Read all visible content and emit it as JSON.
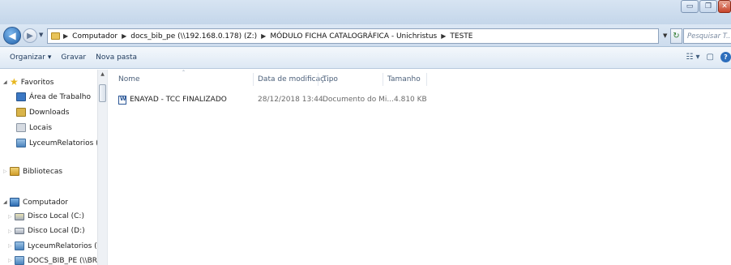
{
  "window_controls": {
    "minimize": "▭",
    "maximize": "❐",
    "close": "✕"
  },
  "address": {
    "crumbs": [
      "Computador",
      "docs_bib_pe (\\\\192.168.0.178) (Z:)",
      "MÓDULO FICHA CATALOGRÁFICA - Unichristus",
      "TESTE"
    ],
    "search_placeholder": "Pesquisar T..."
  },
  "toolbar": {
    "organize_label": "Organizar ▾",
    "burn_label": "Gravar",
    "new_folder_label": "Nova pasta"
  },
  "nav": {
    "favorites": "Favoritos",
    "desktop": "Área de Trabalho",
    "downloads": "Downloads",
    "locais": "Locais",
    "lyceum_fav": "LyceumRelatorios (BR(",
    "libraries": "Bibliotecas",
    "computer": "Computador",
    "disk_c": "Disco Local (C:)",
    "disk_d": "Disco Local (D:)",
    "lyceum_net": "LyceumRelatorios (\\\\B",
    "docs_bib": "DOCS_BIB_PE (\\\\BROT_"
  },
  "columns": {
    "name": "Nome",
    "date": "Data de modificaç...",
    "type": "Tipo",
    "size": "Tamanho"
  },
  "files": [
    {
      "name": "ENAYAD - TCC FINALIZADO",
      "date": "28/12/2018 13:44",
      "type": "Documento do Mi...",
      "size": "4.810 KB"
    }
  ]
}
